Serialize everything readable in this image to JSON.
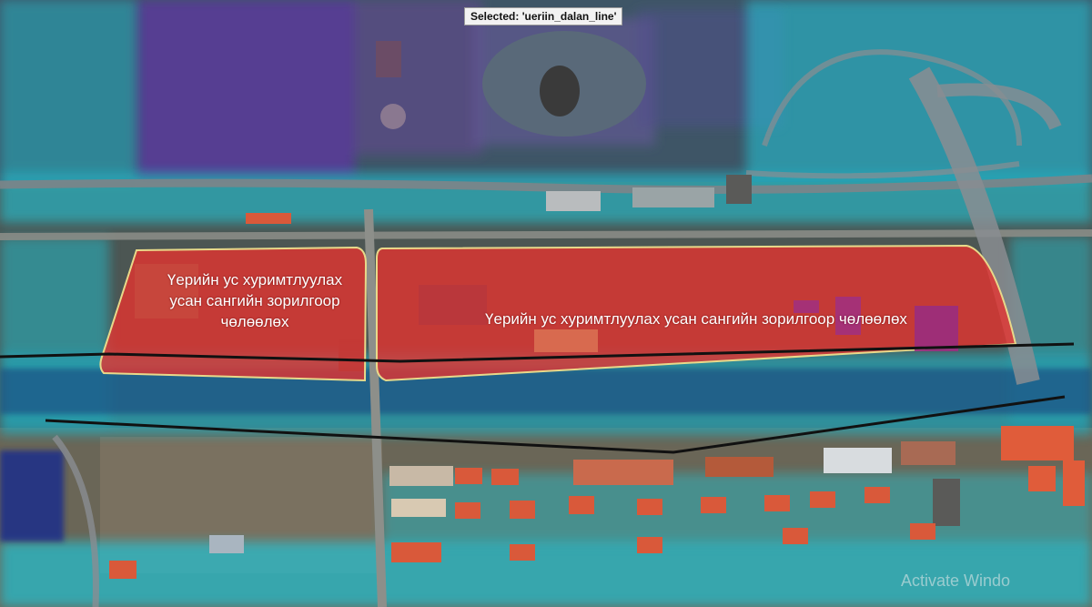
{
  "selection": {
    "banner_text": "Selected: 'ueriin_dalan_line'"
  },
  "zones": [
    {
      "label": "Үерийн ус хуримтлуулах усан сангийн зорилгоор чөлөөлөх"
    },
    {
      "label": "Үерийн ус хуримтлуулах усан сангийн зорилгоор чөлөөлөх"
    }
  ],
  "watermark": "Activate Windo",
  "colors": {
    "zone_fill": "#e8322e",
    "zone_outline": "#e8d98a",
    "flood_overlay": "#21c4d6",
    "deep_water": "#1e2f8a",
    "purple_overlay": "#5b3b9a",
    "rooftops": "#d9593a",
    "line_feature": "#111111"
  }
}
